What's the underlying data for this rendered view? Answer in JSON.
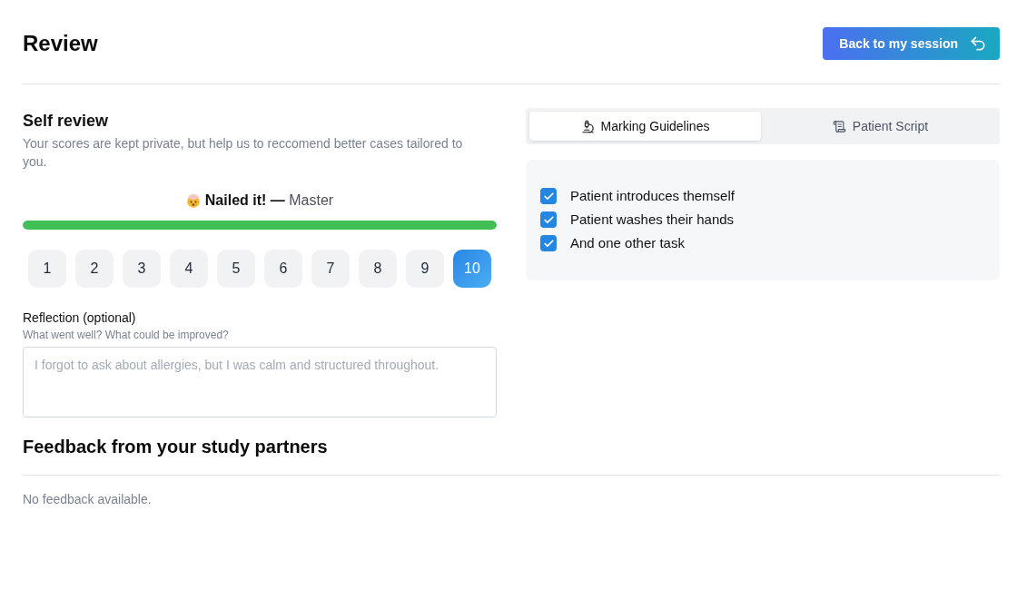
{
  "header": {
    "title": "Review",
    "back_button": {
      "label": "Back to my session"
    }
  },
  "self_review": {
    "title": "Self review",
    "description": "Your scores are kept private, but help us to reccomend better cases tailored to you.",
    "rating": {
      "label": "**Nailed it! —** Master",
      "bar": {
        "level": 1
      },
      "scores": [
        {
          "label": "1",
          "selected": false
        },
        {
          "label": "2",
          "selected": false
        },
        {
          "label": "3",
          "selected": false
        },
        {
          "label": "4",
          "selected": false
        },
        {
          "label": "5",
          "selected": false
        },
        {
          "label": "6",
          "selected": false
        },
        {
          "label": "7",
          "selected": false
        },
        {
          "label": "8",
          "selected": false
        },
        {
          "label": "9",
          "selected": false
        },
        {
          "label": "10",
          "selected": true
        }
      ]
    },
    "reflection": {
      "label": "Reflection (optional)",
      "hint": "What went well? What could be improved?",
      "placeholder": "I forgot to ask about allergies, but I was calm and structured throughout."
    }
  },
  "tabs": [
    {
      "label": "Marking Guidelines",
      "selected": true
    },
    {
      "label": "Patient Script",
      "selected": false
    }
  ],
  "checklist": [
    {
      "label": "Patient introduces themself",
      "checked": true
    },
    {
      "label": "Patient washes their hands",
      "checked": true
    },
    {
      "label": "And one other task",
      "checked": true
    }
  ],
  "feedback": {
    "title": "Feedback from your study partners",
    "empty_text": "No feedback available."
  }
}
